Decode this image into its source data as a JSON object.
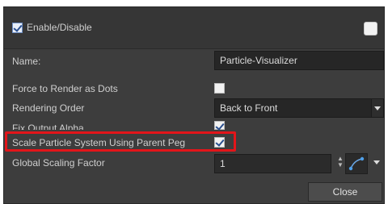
{
  "header": {
    "enable_label": "Enable/Disable"
  },
  "rows": {
    "name_label": "Name:",
    "name_value": "Particle-Visualizer",
    "force_label": "Force to Render as Dots",
    "order_label": "Rendering Order",
    "order_value": "Back to Front",
    "fix_label": "Fix Output Alpha",
    "scale_label": "Scale Particle System Using Parent Peg",
    "global_label": "Global Scaling Factor",
    "global_value": "1"
  },
  "footer": {
    "close_label": "Close"
  },
  "colors": {
    "panel_bg": "#3d3d3d",
    "highlight": "#e3151a",
    "check_accent": "#2a4f8f"
  },
  "icons": [
    "checkmark-icon",
    "chevron-down-icon",
    "spinner-arrows-icon",
    "bezier-curve-icon"
  ]
}
